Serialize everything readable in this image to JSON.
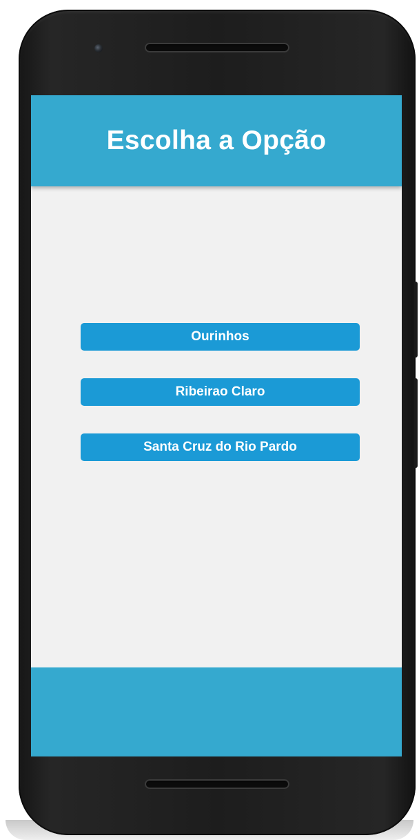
{
  "header": {
    "title": "Escolha a Opção"
  },
  "options": [
    {
      "label": "Ourinhos"
    },
    {
      "label": "Ribeirao Claro"
    },
    {
      "label": "Santa Cruz do Rio Pardo"
    }
  ],
  "colors": {
    "header_bg": "#35a9cf",
    "button_bg": "#1b9ad6",
    "content_bg": "#f1f1f1",
    "device_body": "#1d1d1d"
  }
}
